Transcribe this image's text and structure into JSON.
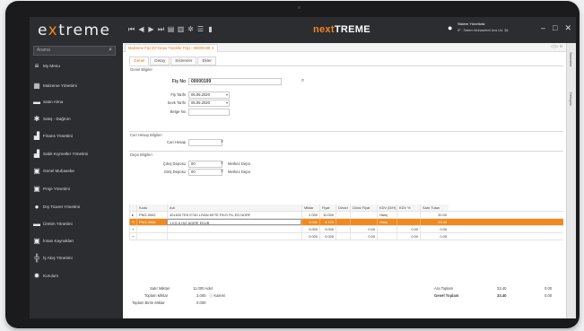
{
  "app": {
    "logo_text": "extreme",
    "brand_next": "next",
    "brand_treme": "TREME",
    "user_name": "Sistem Yöneticisi",
    "user_company": "IP - Sistem Muhasebeli Ana Ltd. Şti.",
    "window_controls": [
      "–",
      "□",
      "✕"
    ],
    "toolbar_icons": [
      "first-icon",
      "prev-icon",
      "next-icon",
      "last-icon",
      "print-icon",
      "export-icon",
      "settings-icon",
      "menu-icon",
      "bookmark-icon"
    ]
  },
  "sidebar": {
    "search_placeholder": "Arama",
    "items": [
      {
        "label": "My Menu",
        "icon": "≡"
      },
      {
        "label": "Malzeme Yönetimi",
        "icon": "▦"
      },
      {
        "label": "Satın Alma",
        "icon": "▬"
      },
      {
        "label": "Satış - Dağıtım",
        "icon": "✱"
      },
      {
        "label": "Finans Yönetimi",
        "icon": "▟"
      },
      {
        "label": "Sabit Kıymetler Yönetimi",
        "icon": "▟"
      },
      {
        "label": "Genel Muhasebe",
        "icon": "▣"
      },
      {
        "label": "Proje Yönetimi",
        "icon": "▣"
      },
      {
        "label": "Dış Ticaret Yönetimi",
        "icon": "●"
      },
      {
        "label": "Üretim Yönetimi",
        "icon": "▬"
      },
      {
        "label": "İnsan Kaynakları",
        "icon": "▣"
      },
      {
        "label": "İş Akış Yönetimi",
        "icon": "╬"
      },
      {
        "label": "Kurulum",
        "icon": "✹"
      }
    ]
  },
  "document": {
    "tab_title": "Malzeme Fişi (57-Depo Transfer Fişi) - 00000199 ✕",
    "nav_arrows": "◁ ▷ ≡",
    "subtabs": [
      "Genel",
      "Detay",
      "Sistemler",
      "Ekler"
    ],
    "right_strip": [
      "Sistemler",
      "Detaylar"
    ],
    "section_general": "Genel Bilgiler",
    "fis_no_label": "Fiş No",
    "fis_no_value": "00000199",
    "fis_tarihi_label": "Fiş Tarihi",
    "fis_tarihi_value": "06.05.2020",
    "sevk_tarihi_label": "Sevk Tarihi",
    "sevk_tarihi_value": "06.05.2020",
    "belge_no_label": "Belge No",
    "section_cari": "Cari Hesap Bilgileri",
    "cari_hesap_label": "Cari Hesap",
    "section_depo": "Depo Bilgileri",
    "cikis_depo_label": "Çıkış Deposu",
    "cikis_depo_value": "00",
    "giris_depo_label": "Giriş Deposu",
    "giris_depo_value": "00",
    "cikis_depo_name": "Merkez Depo",
    "giris_depo_name": "Merkez Depo",
    "grid_headers": [
      "Kodu",
      "Adı",
      "Miktar",
      "Fiyat",
      "Dövizi",
      "Döviz Fiyat",
      "KDV (D/H)",
      "KDV %",
      "Satır Tutarı"
    ],
    "grid_rows": [
      {
        "marker": "▸",
        "code": "PNO-0002",
        "name": "32x155 TEK E740 LIYAN KETE FIKO FIL EG NORF",
        "qty": "2.000",
        "price": "10.000",
        "currency": "",
        "fx_price": "",
        "vat_dh": "Hariç",
        "vat_pct": "",
        "total": "20.00",
        "selected": false
      },
      {
        "marker": "✎",
        "code": "PNO-0008",
        "name": "1 KG 6 HIZ ÄGIRE EKUB",
        "qty": "2.000",
        "price": "6.720",
        "currency": "",
        "fx_price": "",
        "vat_dh": "Hariç",
        "vat_pct": "",
        "total": "13.40",
        "selected": true
      },
      {
        "marker": "+",
        "code": "",
        "name": "",
        "qty": "0.000",
        "price": "0.000",
        "currency": "",
        "fx_price": "0.00",
        "vat_dh": "",
        "vat_pct": "0.00",
        "total": "0.00",
        "selected": false
      },
      {
        "marker": "+",
        "code": "",
        "name": "",
        "qty": "0.000",
        "price": "0.000",
        "currency": "",
        "fx_price": "0.00",
        "vat_dh": "",
        "vat_pct": "0.00",
        "total": "0.00",
        "selected": false
      }
    ],
    "footer": {
      "satir_label": "Satır Miktarı",
      "satir_value": "11.000 Adet",
      "toplam_label": "Toplam Miktar",
      "toplam_value": "3.000",
      "toplam_unit": "ⓘ Kalemi",
      "birim_label": "Toplam Birim Miktar",
      "birim_value": "0.000",
      "ara_label": "Ara Toplam",
      "ara_value1": "33.40",
      "ara_value2": "0.00",
      "genel_label": "Genel Toplam",
      "genel_value1": "33.40",
      "genel_value2": "0.00"
    }
  }
}
